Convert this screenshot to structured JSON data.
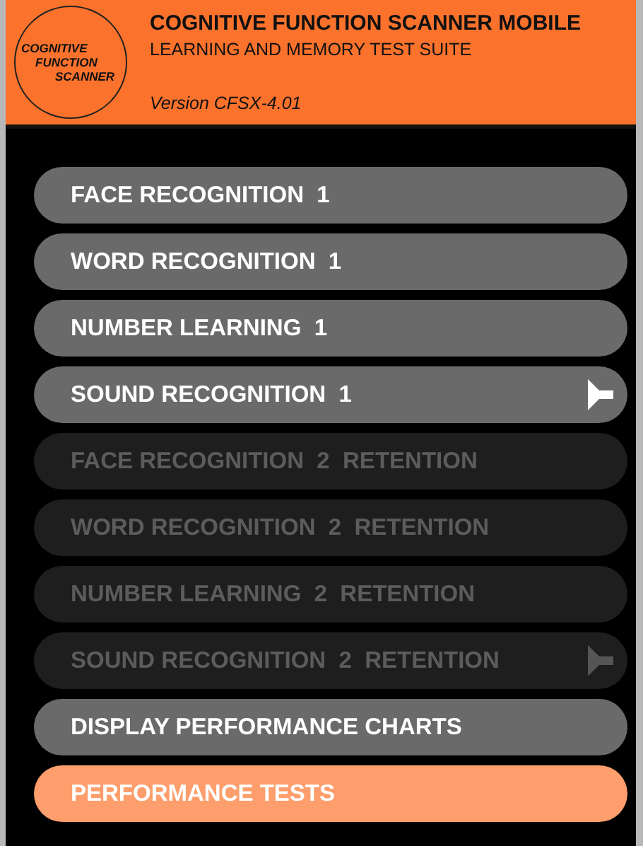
{
  "header": {
    "logo": [
      "COGNITIVE",
      "FUNCTION",
      "SCANNER"
    ],
    "title": "COGNITIVE FUNCTION SCANNER MOBILE",
    "subtitle": "LEARNING AND MEMORY TEST SUITE",
    "version": "Version CFSX-4.01"
  },
  "menu": [
    {
      "label": "FACE RECOGNITION  1",
      "disabled": false,
      "selected": false,
      "speaker": false
    },
    {
      "label": "WORD RECOGNITION  1",
      "disabled": false,
      "selected": false,
      "speaker": false
    },
    {
      "label": "NUMBER LEARNING  1",
      "disabled": false,
      "selected": false,
      "speaker": false
    },
    {
      "label": "SOUND RECOGNITION  1",
      "disabled": false,
      "selected": false,
      "speaker": true
    },
    {
      "label": "FACE RECOGNITION  2  RETENTION",
      "disabled": true,
      "selected": false,
      "speaker": false
    },
    {
      "label": "WORD RECOGNITION  2  RETENTION",
      "disabled": true,
      "selected": false,
      "speaker": false
    },
    {
      "label": "NUMBER LEARNING  2  RETENTION",
      "disabled": true,
      "selected": false,
      "speaker": false
    },
    {
      "label": "SOUND RECOGNITION  2  RETENTION",
      "disabled": true,
      "selected": false,
      "speaker": true
    },
    {
      "label": "DISPLAY PERFORMANCE CHARTS",
      "disabled": false,
      "selected": false,
      "speaker": false
    },
    {
      "label": "PERFORMANCE TESTS",
      "disabled": false,
      "selected": true,
      "speaker": false
    }
  ]
}
